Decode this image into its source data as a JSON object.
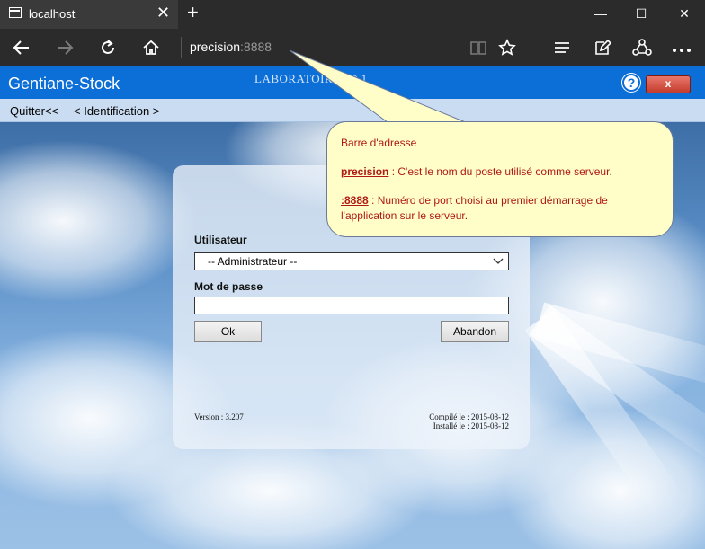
{
  "browser": {
    "tab_title": "localhost",
    "tab_close": "✕",
    "new_tab": "+",
    "address_host": "precision",
    "address_port": ":8888",
    "window_controls": {
      "minimize": "—",
      "maximize": "☐",
      "close": "✕"
    },
    "icons": [
      "page-icon",
      "back-arrow-icon",
      "forward-arrow-icon",
      "refresh-icon",
      "home-icon",
      "reading-view-icon",
      "favorite-star-icon",
      "hub-icon",
      "web-note-icon",
      "share-icon",
      "more-icon"
    ]
  },
  "app": {
    "title": "Gentiane-Stock",
    "lab_title": "LABORATOIRE N° 1",
    "help_label": "?",
    "close_label": "x",
    "menu": {
      "quit": "Quitter<<",
      "identification": "< Identification >"
    }
  },
  "login": {
    "user_label": "Utilisateur",
    "user_value": "-- Administrateur --",
    "password_label": "Mot de passe",
    "password_value": "",
    "ok_label": "Ok",
    "cancel_label": "Abandon",
    "version": "Version : 3.207",
    "compiled": "Compilé le : 2015-08-12",
    "installed": "Installé le : 2015-08-12"
  },
  "callout": {
    "title": "Barre d'adresse",
    "line1_key": "precision",
    "line1_text": " : C'est le nom du poste utilisé comme serveur.",
    "line2_key": ":8888",
    "line2_text": " : Numéro de port choisi au premier démarrage de",
    "line2_cont": "l'application sur le serveur."
  }
}
